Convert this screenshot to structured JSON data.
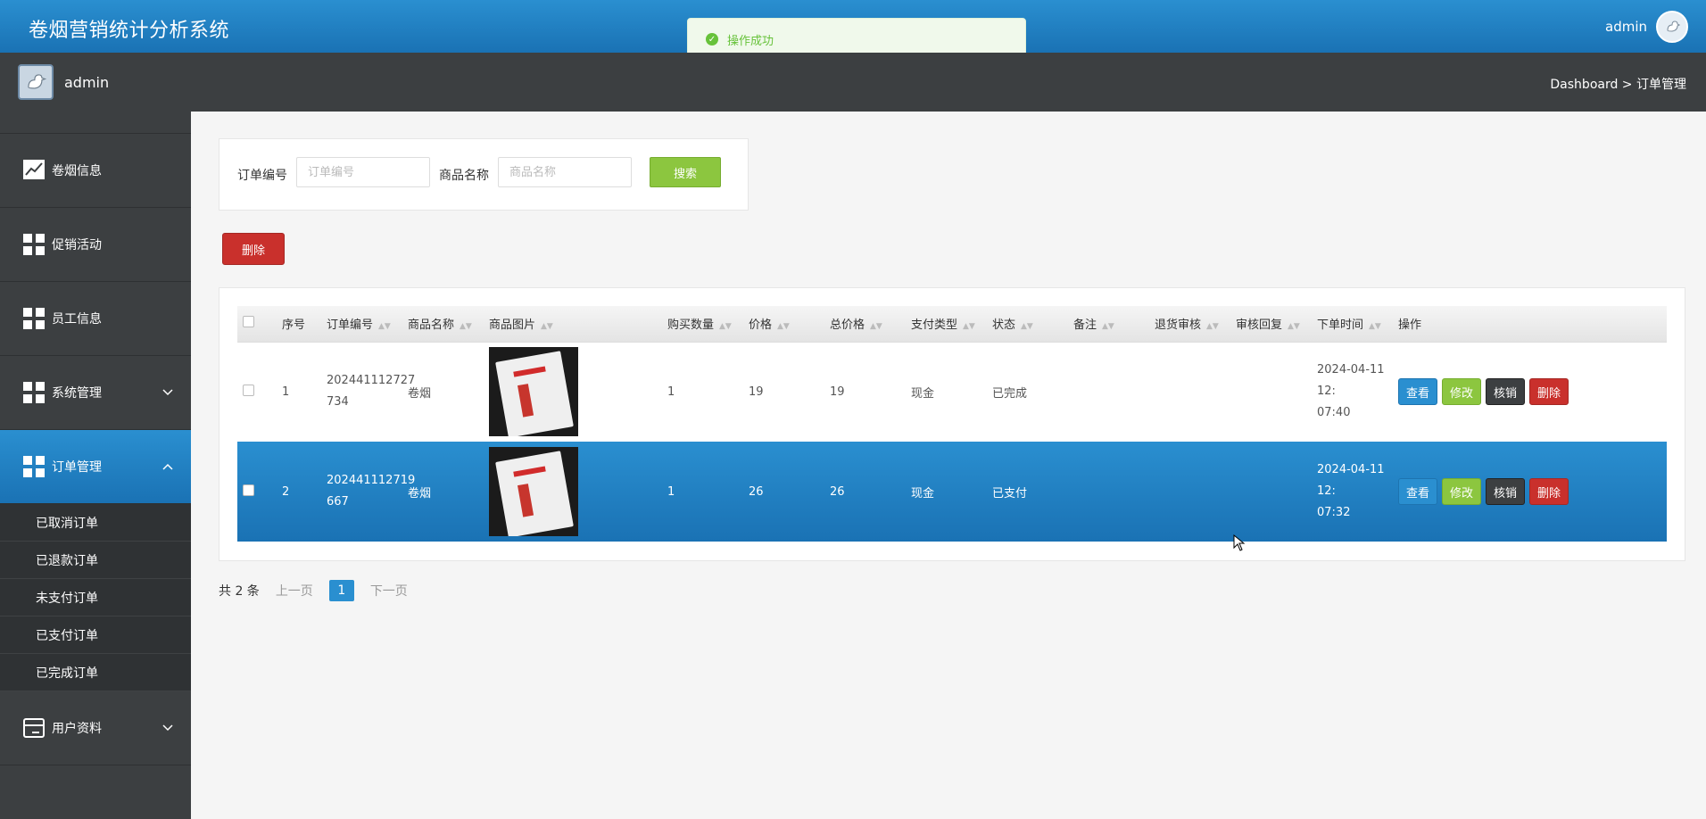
{
  "app": {
    "title": "卷烟营销统计分析系统",
    "user": "admin"
  },
  "toast": {
    "message": "操作成功"
  },
  "subbar": {
    "user": "admin",
    "breadcrumb": "Dashboard > 订单管理"
  },
  "sidebar": {
    "items": [
      {
        "label": "卷烟信息",
        "icon": "chart-icon"
      },
      {
        "label": "促销活动",
        "icon": "grid-icon"
      },
      {
        "label": "员工信息",
        "icon": "grid-icon"
      },
      {
        "label": "系统管理",
        "icon": "grid-icon"
      },
      {
        "label": "订单管理",
        "icon": "grid-icon"
      },
      {
        "label": "用户资料",
        "icon": "card-icon"
      }
    ],
    "sub_items": [
      "已取消订单",
      "已退款订单",
      "未支付订单",
      "已支付订单",
      "已完成订单"
    ]
  },
  "search": {
    "order_no_label": "订单编号",
    "order_no_placeholder": "订单编号",
    "product_label": "商品名称",
    "product_placeholder": "商品名称",
    "button": "搜索"
  },
  "actions": {
    "delete": "删除"
  },
  "table": {
    "headers": [
      "序号",
      "订单编号",
      "商品名称",
      "商品图片",
      "购买数量",
      "价格",
      "总价格",
      "支付类型",
      "状态",
      "备注",
      "退货审核",
      "审核回复",
      "下单时间",
      "操作"
    ],
    "rows": [
      {
        "index": "1",
        "order_no_a": "202441112727",
        "order_no_b": "734",
        "product": "卷烟",
        "qty": "1",
        "price": "19",
        "total": "19",
        "pay_type": "现金",
        "status": "已完成",
        "note": "",
        "return_audit": "",
        "audit_reply": "",
        "time_a": "2024-04-11 12:",
        "time_b": "07:40"
      },
      {
        "index": "2",
        "order_no_a": "202441112719",
        "order_no_b": "667",
        "product": "卷烟",
        "qty": "1",
        "price": "26",
        "total": "26",
        "pay_type": "现金",
        "status": "已支付",
        "note": "",
        "return_audit": "",
        "audit_reply": "",
        "time_a": "2024-04-11 12:",
        "time_b": "07:32"
      }
    ],
    "row_buttons": {
      "view": "查看",
      "edit": "修改",
      "cancel": "核销",
      "delete": "删除"
    }
  },
  "pager": {
    "total": "共 2 条",
    "prev": "上一页",
    "current": "1",
    "next": "下一页"
  },
  "colors": {
    "primary": "#2a8fd0",
    "success": "#8cc63f",
    "danger": "#c9302c",
    "dark": "#3c3f41"
  }
}
